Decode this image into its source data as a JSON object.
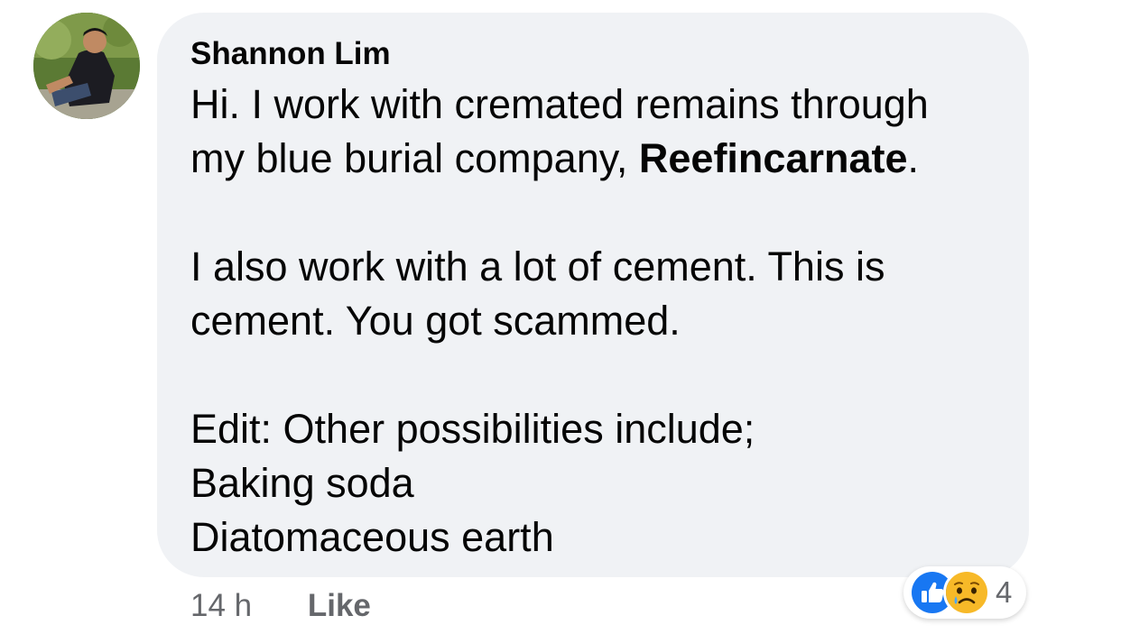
{
  "comment": {
    "author": "Shannon Lim",
    "paragraphs": [
      [
        {
          "text": "Hi. I work with cremated remains through"
        },
        {
          "text": "my blue burial company, ",
          "bold_part": "Reefincarnate",
          "suffix": "."
        }
      ],
      [
        {
          "text": "I also work with a lot of cement. This is"
        },
        {
          "text": "cement. You got scammed."
        }
      ],
      [
        {
          "text": "Edit: Other possibilities include;"
        },
        {
          "text": "Baking soda"
        },
        {
          "text": "Diatomaceous earth"
        }
      ]
    ]
  },
  "meta": {
    "time": "14 h",
    "like_label": "Like"
  },
  "reactions": {
    "icons": [
      "like-icon",
      "sad-icon"
    ],
    "count": "4"
  },
  "colors": {
    "bubble_bg": "#f0f2f5",
    "meta_text": "#65676b",
    "like_blue": "#1877f2",
    "sad_yellow": "#f7b928"
  }
}
